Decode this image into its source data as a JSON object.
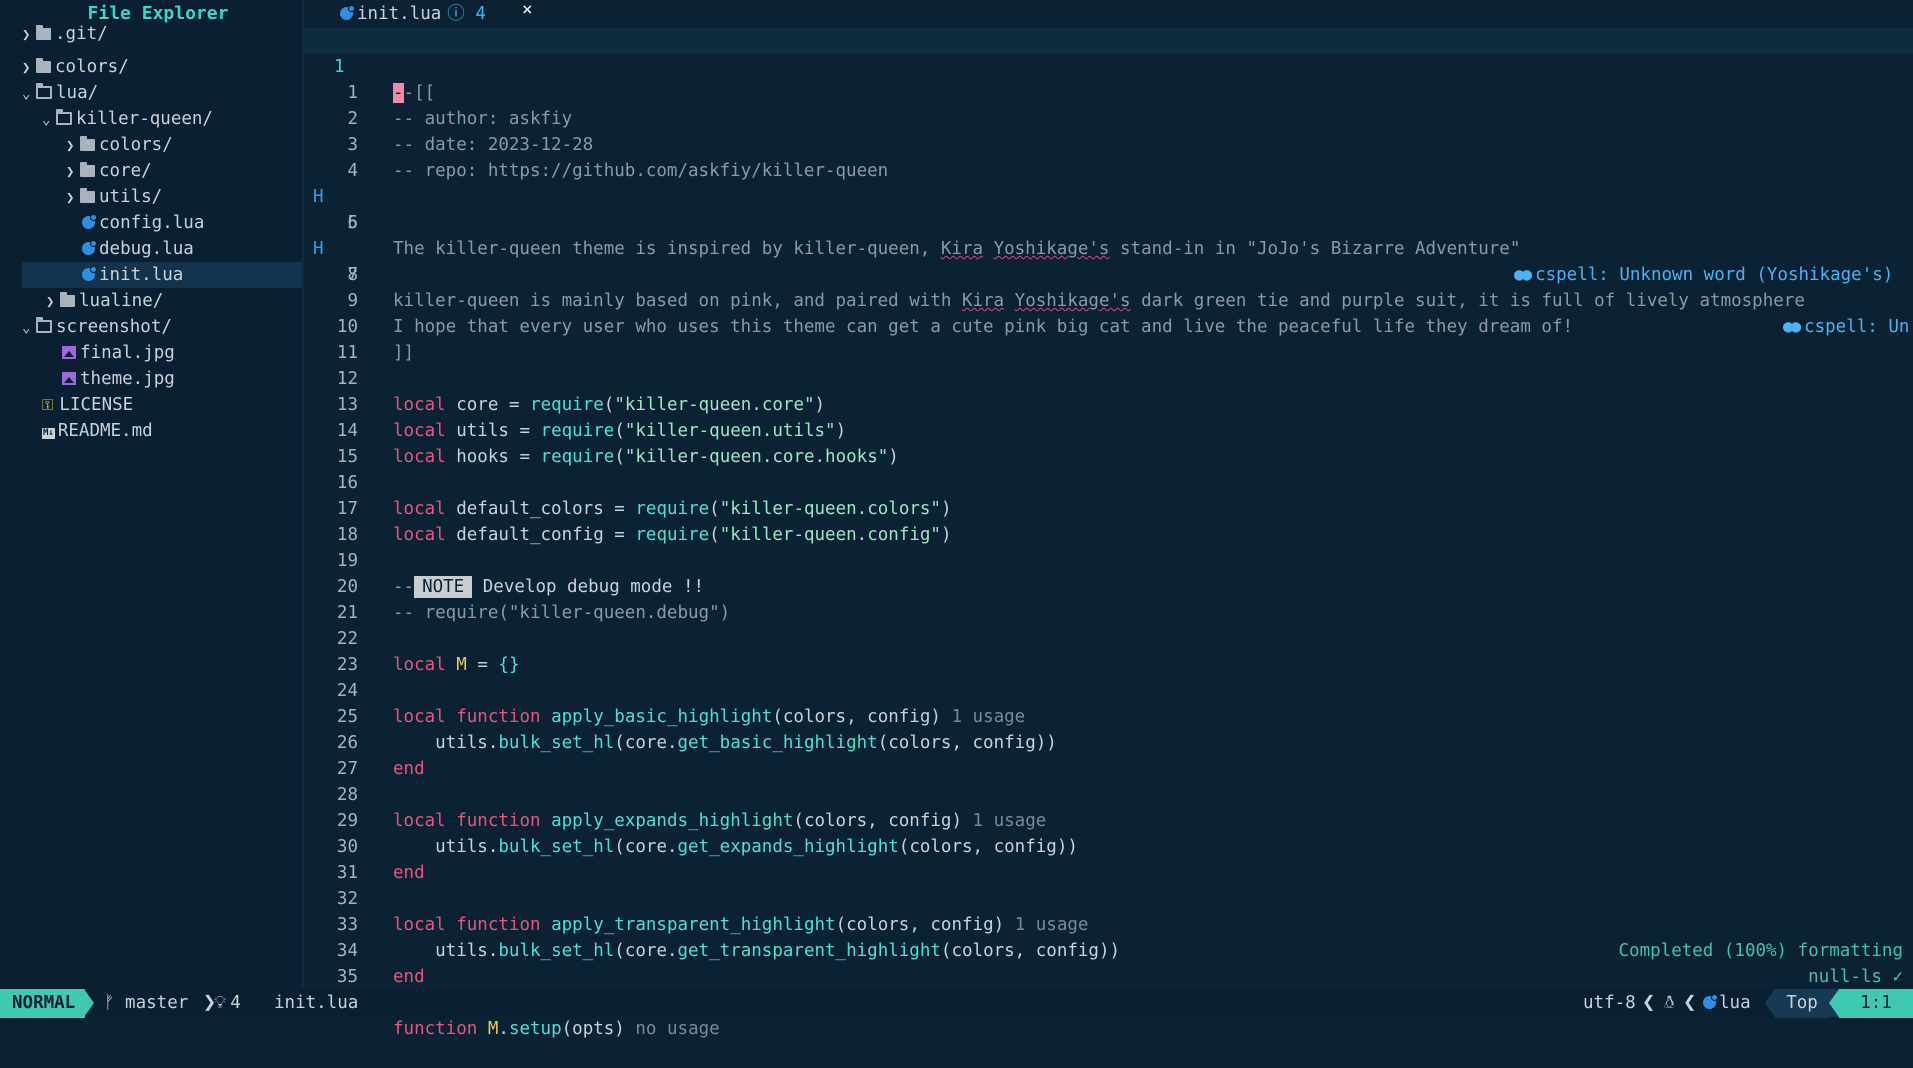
{
  "sidebar": {
    "title": "File Explorer",
    "items": [
      {
        "label": ".git/",
        "kind": "folder",
        "state": "closed"
      },
      {
        "label": "colors/",
        "kind": "folder",
        "state": "closed"
      },
      {
        "label": "lua/",
        "kind": "folder",
        "state": "open"
      },
      {
        "label": "killer-queen/",
        "kind": "folder",
        "state": "open"
      },
      {
        "label": "colors/",
        "kind": "folder",
        "state": "closed"
      },
      {
        "label": "core/",
        "kind": "folder",
        "state": "closed"
      },
      {
        "label": "utils/",
        "kind": "folder",
        "state": "closed"
      },
      {
        "label": "config.lua",
        "kind": "lua"
      },
      {
        "label": "debug.lua",
        "kind": "lua"
      },
      {
        "label": "init.lua",
        "kind": "lua",
        "selected": true
      },
      {
        "label": "lualine/",
        "kind": "folder",
        "state": "closed"
      },
      {
        "label": "screenshot/",
        "kind": "folder",
        "state": "open"
      },
      {
        "label": "final.jpg",
        "kind": "image"
      },
      {
        "label": "theme.jpg",
        "kind": "image"
      },
      {
        "label": "LICENSE",
        "kind": "license"
      },
      {
        "label": "README.md",
        "kind": "markdown"
      }
    ]
  },
  "tab": {
    "name": "init.lua",
    "diag_icon": "ⓘ",
    "diag_count": "4",
    "close": "×"
  },
  "editor": {
    "current_line": "1",
    "lines": {
      "l1": "-[[",
      "l1_cursor": "-",
      "l2": "-- author: askfiy",
      "l3": "-- date: 2023-12-28",
      "l4": "-- repo: https://github.com/askfiy/killer-queen",
      "l6a": "The killer-queen theme is inspired by killer-queen, ",
      "l6b": "Kira",
      "l6c": "Yoshikage's",
      "l6d": " stand-in in \"JoJo's Bizarre Adventure\"",
      "l8a": "killer-queen is mainly based on pink, and paired with ",
      "l8b": "Kira",
      "l8c": "Yoshikage's",
      "l8d": " dark green tie and purple suit, it is full of lively atmosphere",
      "l10": "I hope that every user who uses this theme can get a cute pink big cat and live the peaceful life they dream of!",
      "l11": "]]",
      "note": "NOTE",
      "note_prefix": "--",
      "note_text": " Develop debug mode !!",
      "l21": "-- require(\"killer-queen.debug\")",
      "usage1": "1 usage",
      "no_usage": "no usage"
    },
    "diagnostics": {
      "d5": "cspell: Unknown word (Yoshikage's)",
      "d7": "cspell: Un"
    },
    "gutter_signs": {
      "l6": "H",
      "l8": "H"
    }
  },
  "lsp_progress": {
    "line1": "Completed (100%) formatting",
    "line2": "null-ls ✓"
  },
  "statusline": {
    "mode": "NORMAL",
    "branch": "master",
    "diag_count": "4",
    "filename": "init.lua",
    "encoding": "utf-8",
    "filetype": "lua",
    "position_pct": "Top",
    "line_col": "1:1"
  },
  "colors": {
    "background": "#0b2235",
    "accent": "#3ec9b3",
    "keyword": "#e8567e",
    "function": "#4fe0cc",
    "string": "#9ee5c3",
    "comment": "#8e98a3",
    "diagnostic": "#4fb2f0"
  }
}
